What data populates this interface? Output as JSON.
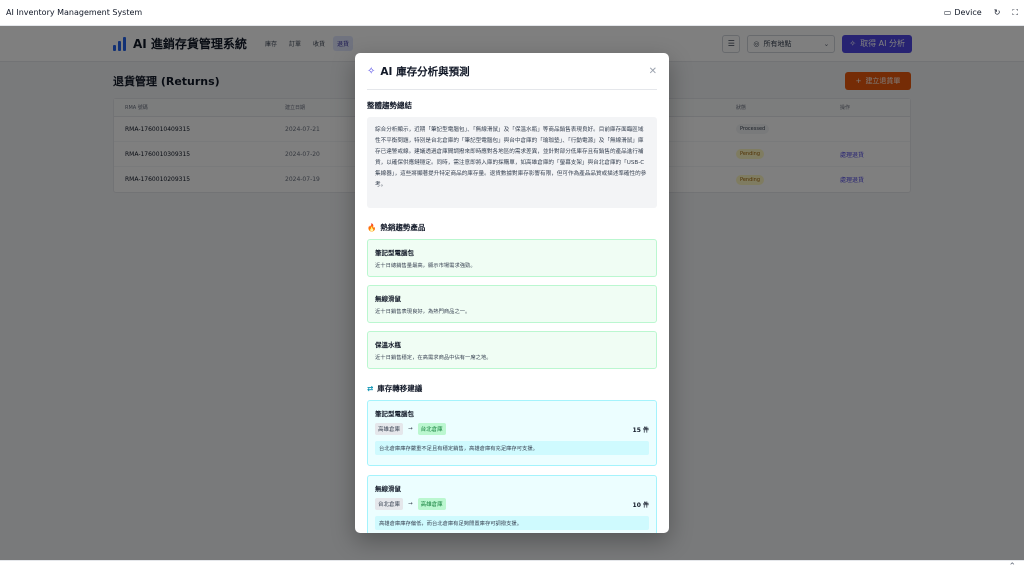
{
  "window": {
    "title": "AI Inventory Management System",
    "device_label": "Device"
  },
  "header": {
    "app_title": "AI 進銷存貨管理系統",
    "nav": [
      "庫存",
      "訂單",
      "收貨",
      "退貨"
    ],
    "active_nav": "退貨",
    "location_select": "所有地點",
    "ai_button": "取得 AI 分析"
  },
  "page": {
    "title": "退貨管理 (Returns)",
    "create_button": "建立退貨單"
  },
  "table": {
    "columns": [
      "RMA 號碼",
      "建立日期",
      "狀態",
      "操作"
    ],
    "rows": [
      {
        "rma": "RMA-1760010409315",
        "date": "2024-07-21",
        "status": "Processed",
        "action": ""
      },
      {
        "rma": "RMA-1760010309315",
        "date": "2024-07-20",
        "status": "Pending",
        "action": "處理退貨"
      },
      {
        "rma": "RMA-1760010209315",
        "date": "2024-07-19",
        "status": "Pending",
        "action": "處理退貨"
      }
    ]
  },
  "modal": {
    "title": "AI 庫存分析與預測",
    "summary_title": "整體趨勢總結",
    "summary_text": "綜合分析顯示，近期「筆記型電腦包」、「無線滑鼠」及「保溫水瓶」等商品銷售表現良好。目前庫存面臨區域性不平衡問題，特別是台北倉庫的「筆記型電腦包」與台中倉庫的「瑜珈墊」、「行動電源」及「無線滑鼠」庫存已達警戒線。建議透過倉庫間調撥來即時應對各地區的需求差異，並針對部分低庫存且有銷售的產品進行補貨，以確保供應鏈穩定。同時，需注意即將入庫的採購單，如高雄倉庫的「螢幕支架」與台北倉庫的「USB-C集線器」，這些將顯著提升特定商品的庫存量。退貨數據對庫存影響有限，但可作為產品品質或描述準確性的參考。",
    "trending_title": "熱銷趨勢產品",
    "trending_icon": "🔥",
    "trending": [
      {
        "name": "筆記型電腦包",
        "desc": "近十日總銷售量最高，顯示市場需求強勁。"
      },
      {
        "name": "無線滑鼠",
        "desc": "近十日銷售表現良好，為熱門商品之一。"
      },
      {
        "name": "保溫水瓶",
        "desc": "近十日銷售穩定，在高需求商品中佔有一席之地。"
      }
    ],
    "transfer_title": "庫存轉移建議",
    "transfers": [
      {
        "name": "筆記型電腦包",
        "from": "高雄倉庫",
        "to": "台北倉庫",
        "qty": "15 件",
        "note": "台北倉庫庫存嚴重不足且有穩定銷售，高雄倉庫有充足庫存可支援。"
      },
      {
        "name": "無線滑鼠",
        "from": "台北倉庫",
        "to": "高雄倉庫",
        "qty": "10 件",
        "note": "高雄倉庫庫存偏低，而台北倉庫有足夠閒置庫存可調撥支援。"
      }
    ]
  },
  "colors": {
    "primary": "#4f46e5",
    "accent_orange": "#ea580c",
    "trend_card_bg": "#f0fdf4",
    "transfer_card_bg": "#ecfeff"
  }
}
